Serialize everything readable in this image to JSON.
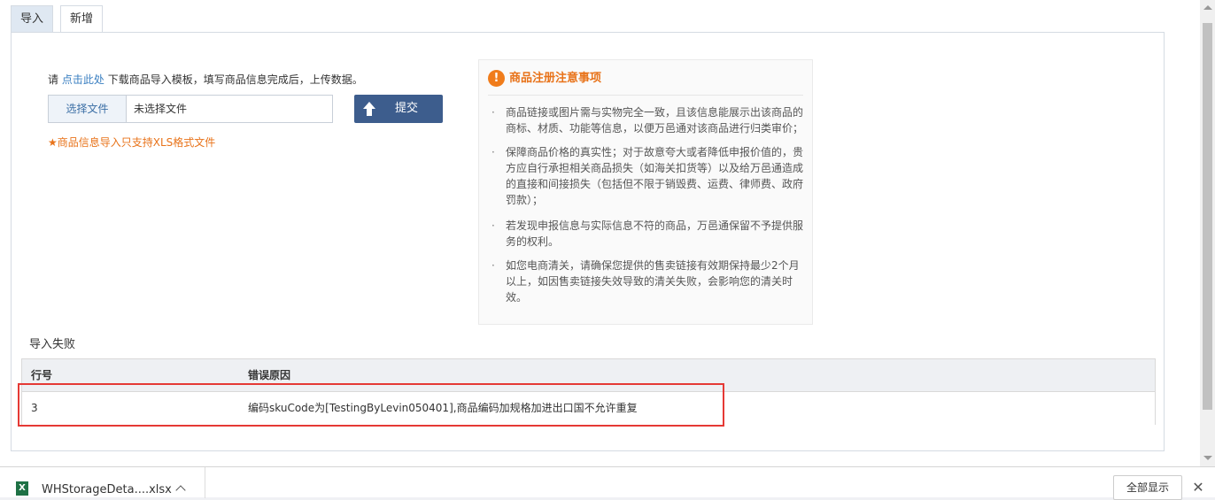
{
  "tabs": [
    {
      "label": "导入"
    },
    {
      "label": "新增"
    }
  ],
  "import": {
    "hint_prefix": "请",
    "hint_link": "点击此处",
    "hint_suffix": "下载商品导入模板，填写商品信息完成后，上传数据。",
    "choose_file_label": "选择文件",
    "file_name": "未选择文件",
    "submit_label": "提交",
    "warning": "商品信息导入只支持XLS格式文件"
  },
  "notice": {
    "title": "商品注册注意事项",
    "items": [
      "商品链接或图片需与实物完全一致，且该信息能展示出该商品的商标、材质、功能等信息，以便万邑通对该商品进行归类审价；",
      "保障商品价格的真实性；对于故意夸大或者降低申报价值的，贵方应自行承担相关商品损失（如海关扣货等）以及给万邑通造成的直接和间接损失（包括但不限于销毁费、运费、律师费、政府罚款）；",
      "若发现申报信息与实际信息不符的商品，万邑通保留不予提供服务的权利。",
      "如您电商清关，请确保您提供的售卖链接有效期保持最少2个月以上，如因售卖链接失效导致的清关失败，会影响您的清关时效。"
    ]
  },
  "errors": {
    "section_title": "导入失败",
    "columns": [
      "行号",
      "错误原因"
    ],
    "rows": [
      {
        "line": "3",
        "reason": "编码skuCode为[TestingByLevin050401],商品编码加规格加进出口国不允许重复"
      }
    ]
  },
  "download_bar": {
    "file_name": "WHStorageDeta....xlsx",
    "show_all_label": "全部显示",
    "close_glyph": "✕"
  },
  "colors": {
    "accent": "#3d5d8d",
    "warning": "#e8731a",
    "link": "#3a7fc1",
    "highlight": "#e53935"
  }
}
